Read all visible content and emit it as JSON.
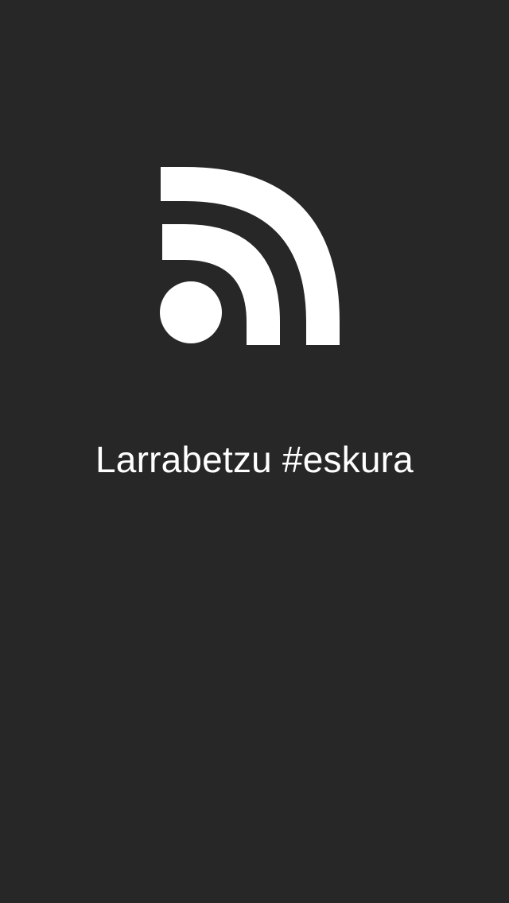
{
  "splash": {
    "background_color": "#272727",
    "foreground_color": "#ffffff",
    "logo_icon": "rss-feed-icon",
    "app_name": "Larrabetzu #eskura"
  }
}
